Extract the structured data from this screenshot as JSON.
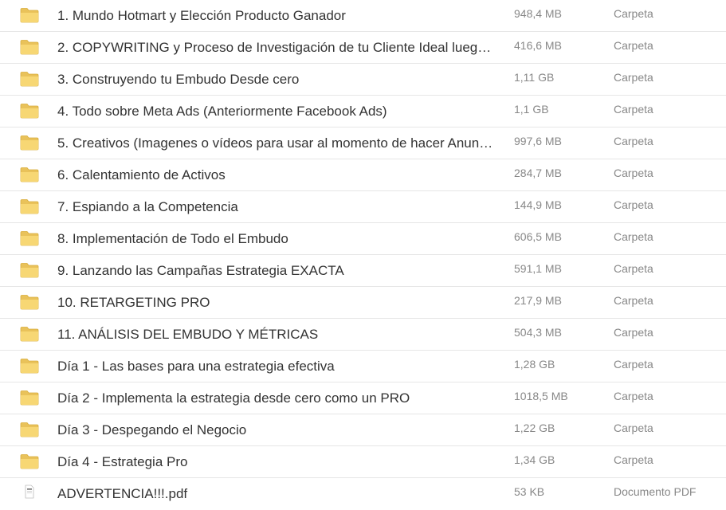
{
  "colors": {
    "folder_body": "#F7D774",
    "folder_tab": "#E9C25A",
    "folder_edge": "#D9AE3C",
    "text_primary": "#333333",
    "text_secondary": "#888888",
    "divider": "#E6E6E6"
  },
  "files": [
    {
      "name": "1. Mundo Hotmart y Elección Producto Ganador",
      "size": "948,4 MB",
      "type": "Carpeta",
      "icon": "folder-icon"
    },
    {
      "name": "2. COPYWRITING y Proceso de Investigación de tu Cliente Ideal lueg…",
      "size": "416,6 MB",
      "type": "Carpeta",
      "icon": "folder-icon"
    },
    {
      "name": "3. Construyendo tu Embudo Desde cero",
      "size": "1,11 GB",
      "type": "Carpeta",
      "icon": "folder-icon"
    },
    {
      "name": "4. Todo sobre Meta Ads (Anteriormente Facebook Ads)",
      "size": "1,1 GB",
      "type": "Carpeta",
      "icon": "folder-icon"
    },
    {
      "name": "5. Creativos (Imagenes o vídeos para usar al momento de hacer Anunc…",
      "size": "997,6 MB",
      "type": "Carpeta",
      "icon": "folder-icon"
    },
    {
      "name": "6. Calentamiento de Activos",
      "size": "284,7 MB",
      "type": "Carpeta",
      "icon": "folder-icon"
    },
    {
      "name": "7. Espiando a la Competencia",
      "size": "144,9 MB",
      "type": "Carpeta",
      "icon": "folder-icon"
    },
    {
      "name": "8. Implementación de Todo el Embudo",
      "size": "606,5 MB",
      "type": "Carpeta",
      "icon": "folder-icon"
    },
    {
      "name": "9. Lanzando las Campañas Estrategia EXACTA",
      "size": "591,1 MB",
      "type": "Carpeta",
      "icon": "folder-icon"
    },
    {
      "name": "10. RETARGETING PRO",
      "size": "217,9 MB",
      "type": "Carpeta",
      "icon": "folder-icon"
    },
    {
      "name": "11. ANÁLISIS DEL EMBUDO Y MÉTRICAS",
      "size": "504,3 MB",
      "type": "Carpeta",
      "icon": "folder-icon"
    },
    {
      "name": "Día 1 - Las bases para una estrategia efectiva",
      "size": "1,28 GB",
      "type": "Carpeta",
      "icon": "folder-icon"
    },
    {
      "name": "Día 2 - Implementa la estrategia desde cero como un PRO",
      "size": "1018,5 MB",
      "type": "Carpeta",
      "icon": "folder-icon"
    },
    {
      "name": "Día 3 - Despegando el Negocio",
      "size": "1,22 GB",
      "type": "Carpeta",
      "icon": "folder-icon"
    },
    {
      "name": "Día 4 - Estrategia Pro",
      "size": "1,34 GB",
      "type": "Carpeta",
      "icon": "folder-icon"
    },
    {
      "name": "ADVERTENCIA!!!.pdf",
      "size": "53 KB",
      "type": "Documento PDF",
      "icon": "pdf-file-icon"
    }
  ]
}
